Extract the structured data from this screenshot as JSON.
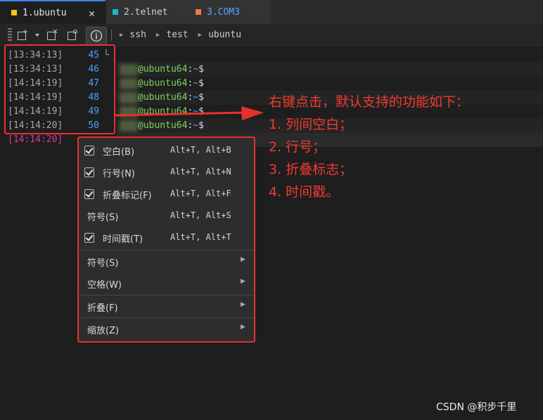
{
  "tabs": [
    {
      "label": "1.ubuntu",
      "color": "#f2c518",
      "close": "✕"
    },
    {
      "label": "2.telnet",
      "color": "#17b8c9"
    },
    {
      "label": "3.COM3",
      "color": "#ef7a43"
    }
  ],
  "breadcrumb": [
    "ssh",
    "test",
    "ubuntu"
  ],
  "terminal": {
    "lines": [
      {
        "ts": "[13:34:13]",
        "num": "45",
        "fold": "└",
        "user": "",
        "host": "",
        "colon": "",
        "path": "",
        "dollar": ""
      },
      {
        "ts": "[13:34:13]",
        "num": "46",
        "user": "@ubuntu64",
        "colon": ":",
        "path": "~",
        "dollar": "$"
      },
      {
        "ts": "[14:14:19]",
        "num": "47",
        "user": "@ubuntu64",
        "colon": ":",
        "path": "~",
        "dollar": "$"
      },
      {
        "ts": "[14:14:19]",
        "num": "48",
        "user": "@ubuntu64",
        "colon": ":",
        "path": "~",
        "dollar": "$"
      },
      {
        "ts": "[14:14:19]",
        "num": "49",
        "user": "@ubuntu64",
        "colon": ":",
        "path": "~",
        "dollar": "$"
      },
      {
        "ts": "[14:14:20]",
        "num": "50",
        "user": "@ubuntu64",
        "colon": ":",
        "path": "~",
        "dollar": "$"
      }
    ],
    "current_ts": "[14:14:20]"
  },
  "annotation": {
    "title": "右键点击，默认支持的功能如下：",
    "items": [
      "1. 列间空白；",
      "2. 行号；",
      "3. 折叠标志；",
      "4. 时间戳。"
    ]
  },
  "menu": {
    "items": [
      {
        "label": "空白(B)",
        "shortcut": "Alt+T, Alt+B",
        "checked": true
      },
      {
        "label": "行号(N)",
        "shortcut": "Alt+T, Alt+N",
        "checked": true
      },
      {
        "label": "折叠标记(F)",
        "shortcut": "Alt+T, Alt+F",
        "checked": true
      },
      {
        "label": "符号(S)",
        "shortcut": "Alt+T, Alt+S",
        "checked": false
      },
      {
        "label": "时间戳(T)",
        "shortcut": "Alt+T, Alt+T",
        "checked": true
      }
    ],
    "submenus": [
      {
        "label": "符号(S)",
        "arrow": "▶"
      },
      {
        "label": "空格(W)",
        "arrow": "▶"
      },
      {
        "label": "折叠(F)",
        "arrow": "▶"
      },
      {
        "label": "缩放(Z)",
        "arrow": "▶"
      }
    ]
  },
  "watermark": "CSDN @积步千里",
  "colors": {
    "highlight": "#e5322d",
    "accent": "#3b82f6",
    "user": "#7fd35c",
    "path": "#4aa3ff",
    "current_ts": "#d23a9a"
  }
}
